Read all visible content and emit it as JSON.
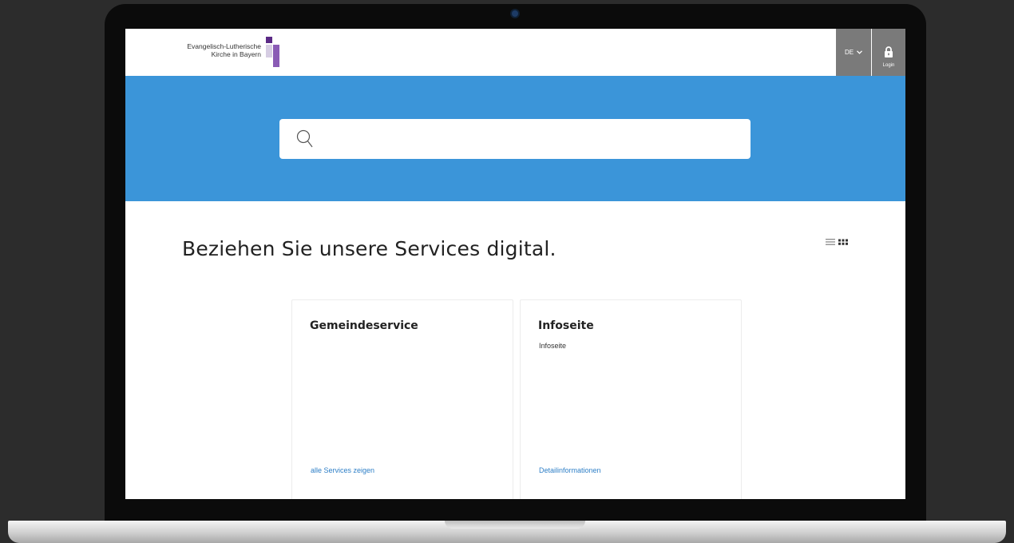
{
  "header": {
    "logo_line1": "Evangelisch-Lutherische",
    "logo_line2": "Kirche in Bayern",
    "language": "DE",
    "login_label": "Login"
  },
  "search": {
    "placeholder": ""
  },
  "main": {
    "title": "Beziehen Sie unsere Services digital.",
    "cards": [
      {
        "title": "Gemeindeservice",
        "description": "",
        "link": "alle Services zeigen"
      },
      {
        "title": "Infoseite",
        "description": "Infoseite",
        "link": "Detailinformationen"
      }
    ]
  },
  "colors": {
    "hero": "#3b95d9",
    "header_buttons": "#7a7a7a",
    "link": "#2e7fc7",
    "logo_purple": "#5b2a86"
  }
}
